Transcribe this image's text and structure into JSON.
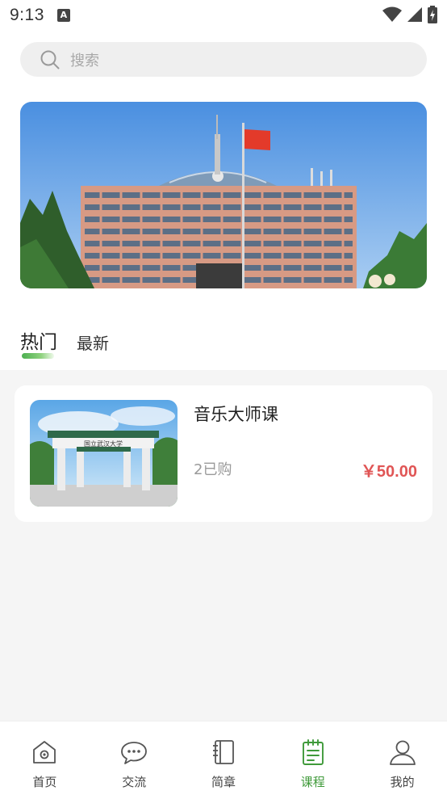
{
  "status_bar": {
    "time": "9:13",
    "indicator": "A"
  },
  "search": {
    "placeholder": "搜索"
  },
  "tabs": {
    "hot": "热门",
    "latest": "最新"
  },
  "courses": [
    {
      "title": "音乐大师课",
      "sold": "2已购",
      "price": "￥50.00"
    }
  ],
  "bottom_nav": [
    {
      "label": "首页",
      "icon": "home-icon"
    },
    {
      "label": "交流",
      "icon": "chat-icon"
    },
    {
      "label": "简章",
      "icon": "brochure-icon"
    },
    {
      "label": "课程",
      "icon": "course-icon",
      "active": true
    },
    {
      "label": "我的",
      "icon": "profile-icon"
    }
  ],
  "colors": {
    "accent": "#3f9a3a",
    "price": "#e05555"
  }
}
